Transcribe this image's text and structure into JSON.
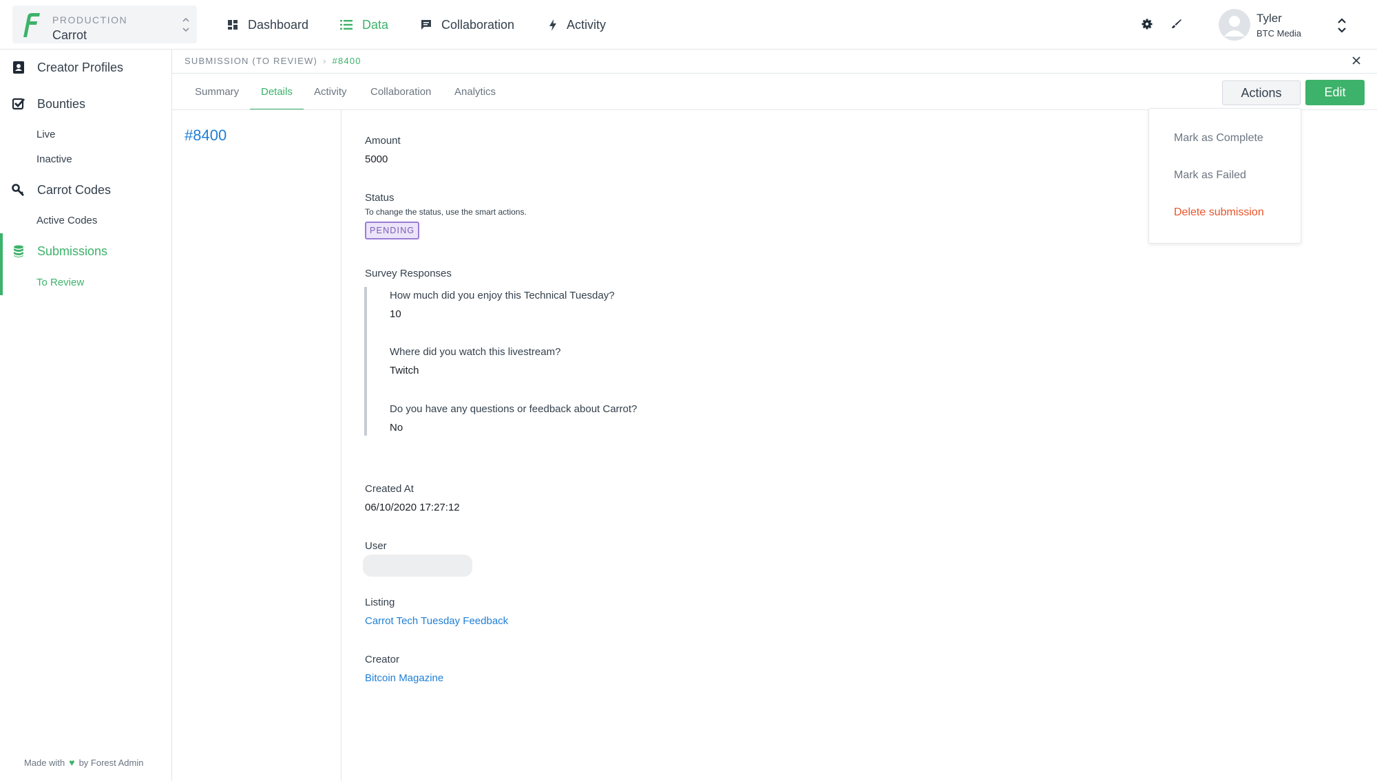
{
  "env": {
    "label": "PRODUCTION",
    "name": "Carrot"
  },
  "nav": [
    {
      "label": "Dashboard",
      "icon": "dashboard-icon"
    },
    {
      "label": "Data",
      "icon": "list-icon"
    },
    {
      "label": "Collaboration",
      "icon": "chat-icon"
    },
    {
      "label": "Activity",
      "icon": "bolt-icon"
    }
  ],
  "user": {
    "name": "Tyler",
    "org": "BTC Media"
  },
  "sidebar": {
    "items": [
      {
        "label": "Creator Profiles"
      },
      {
        "label": "Bounties"
      },
      {
        "label": "Carrot Codes"
      },
      {
        "label": "Submissions"
      }
    ],
    "subs": {
      "live": "Live",
      "inactive": "Inactive",
      "active_codes": "Active Codes",
      "to_review": "To Review"
    },
    "footer": {
      "made_with": "Made with",
      "by": "by Forest Admin"
    }
  },
  "breadcrumb": {
    "parent": "SUBMISSION (TO REVIEW)",
    "current": "#8400"
  },
  "tabs": [
    "Summary",
    "Details",
    "Activity",
    "Collaboration",
    "Analytics"
  ],
  "buttons": {
    "actions": "Actions",
    "edit": "Edit"
  },
  "record": {
    "id": "#8400",
    "amount_label": "Amount",
    "amount": "5000",
    "status_label": "Status",
    "status_help": "To change the status, use the smart actions.",
    "status": "PENDING",
    "survey_label": "Survey Responses",
    "survey": [
      {
        "q": "How much did you enjoy this Technical Tuesday?",
        "a": "10"
      },
      {
        "q": "Where did you watch this livestream?",
        "a": "Twitch"
      },
      {
        "q": "Do you have any questions or feedback about Carrot?",
        "a": "No"
      }
    ],
    "created_label": "Created At",
    "created": "06/10/2020 17:27:12",
    "user_label": "User",
    "listing_label": "Listing",
    "listing": "Carrot Tech Tuesday Feedback",
    "creator_label": "Creator",
    "creator": "Bitcoin Magazine"
  },
  "dropdown": {
    "items": [
      "Mark as Complete",
      "Mark as Failed",
      "Delete submission"
    ]
  },
  "colors": {
    "accent": "#3db26a",
    "link": "#1f7fd6",
    "danger": "#e8542a",
    "badge": "#9b7cd6"
  }
}
